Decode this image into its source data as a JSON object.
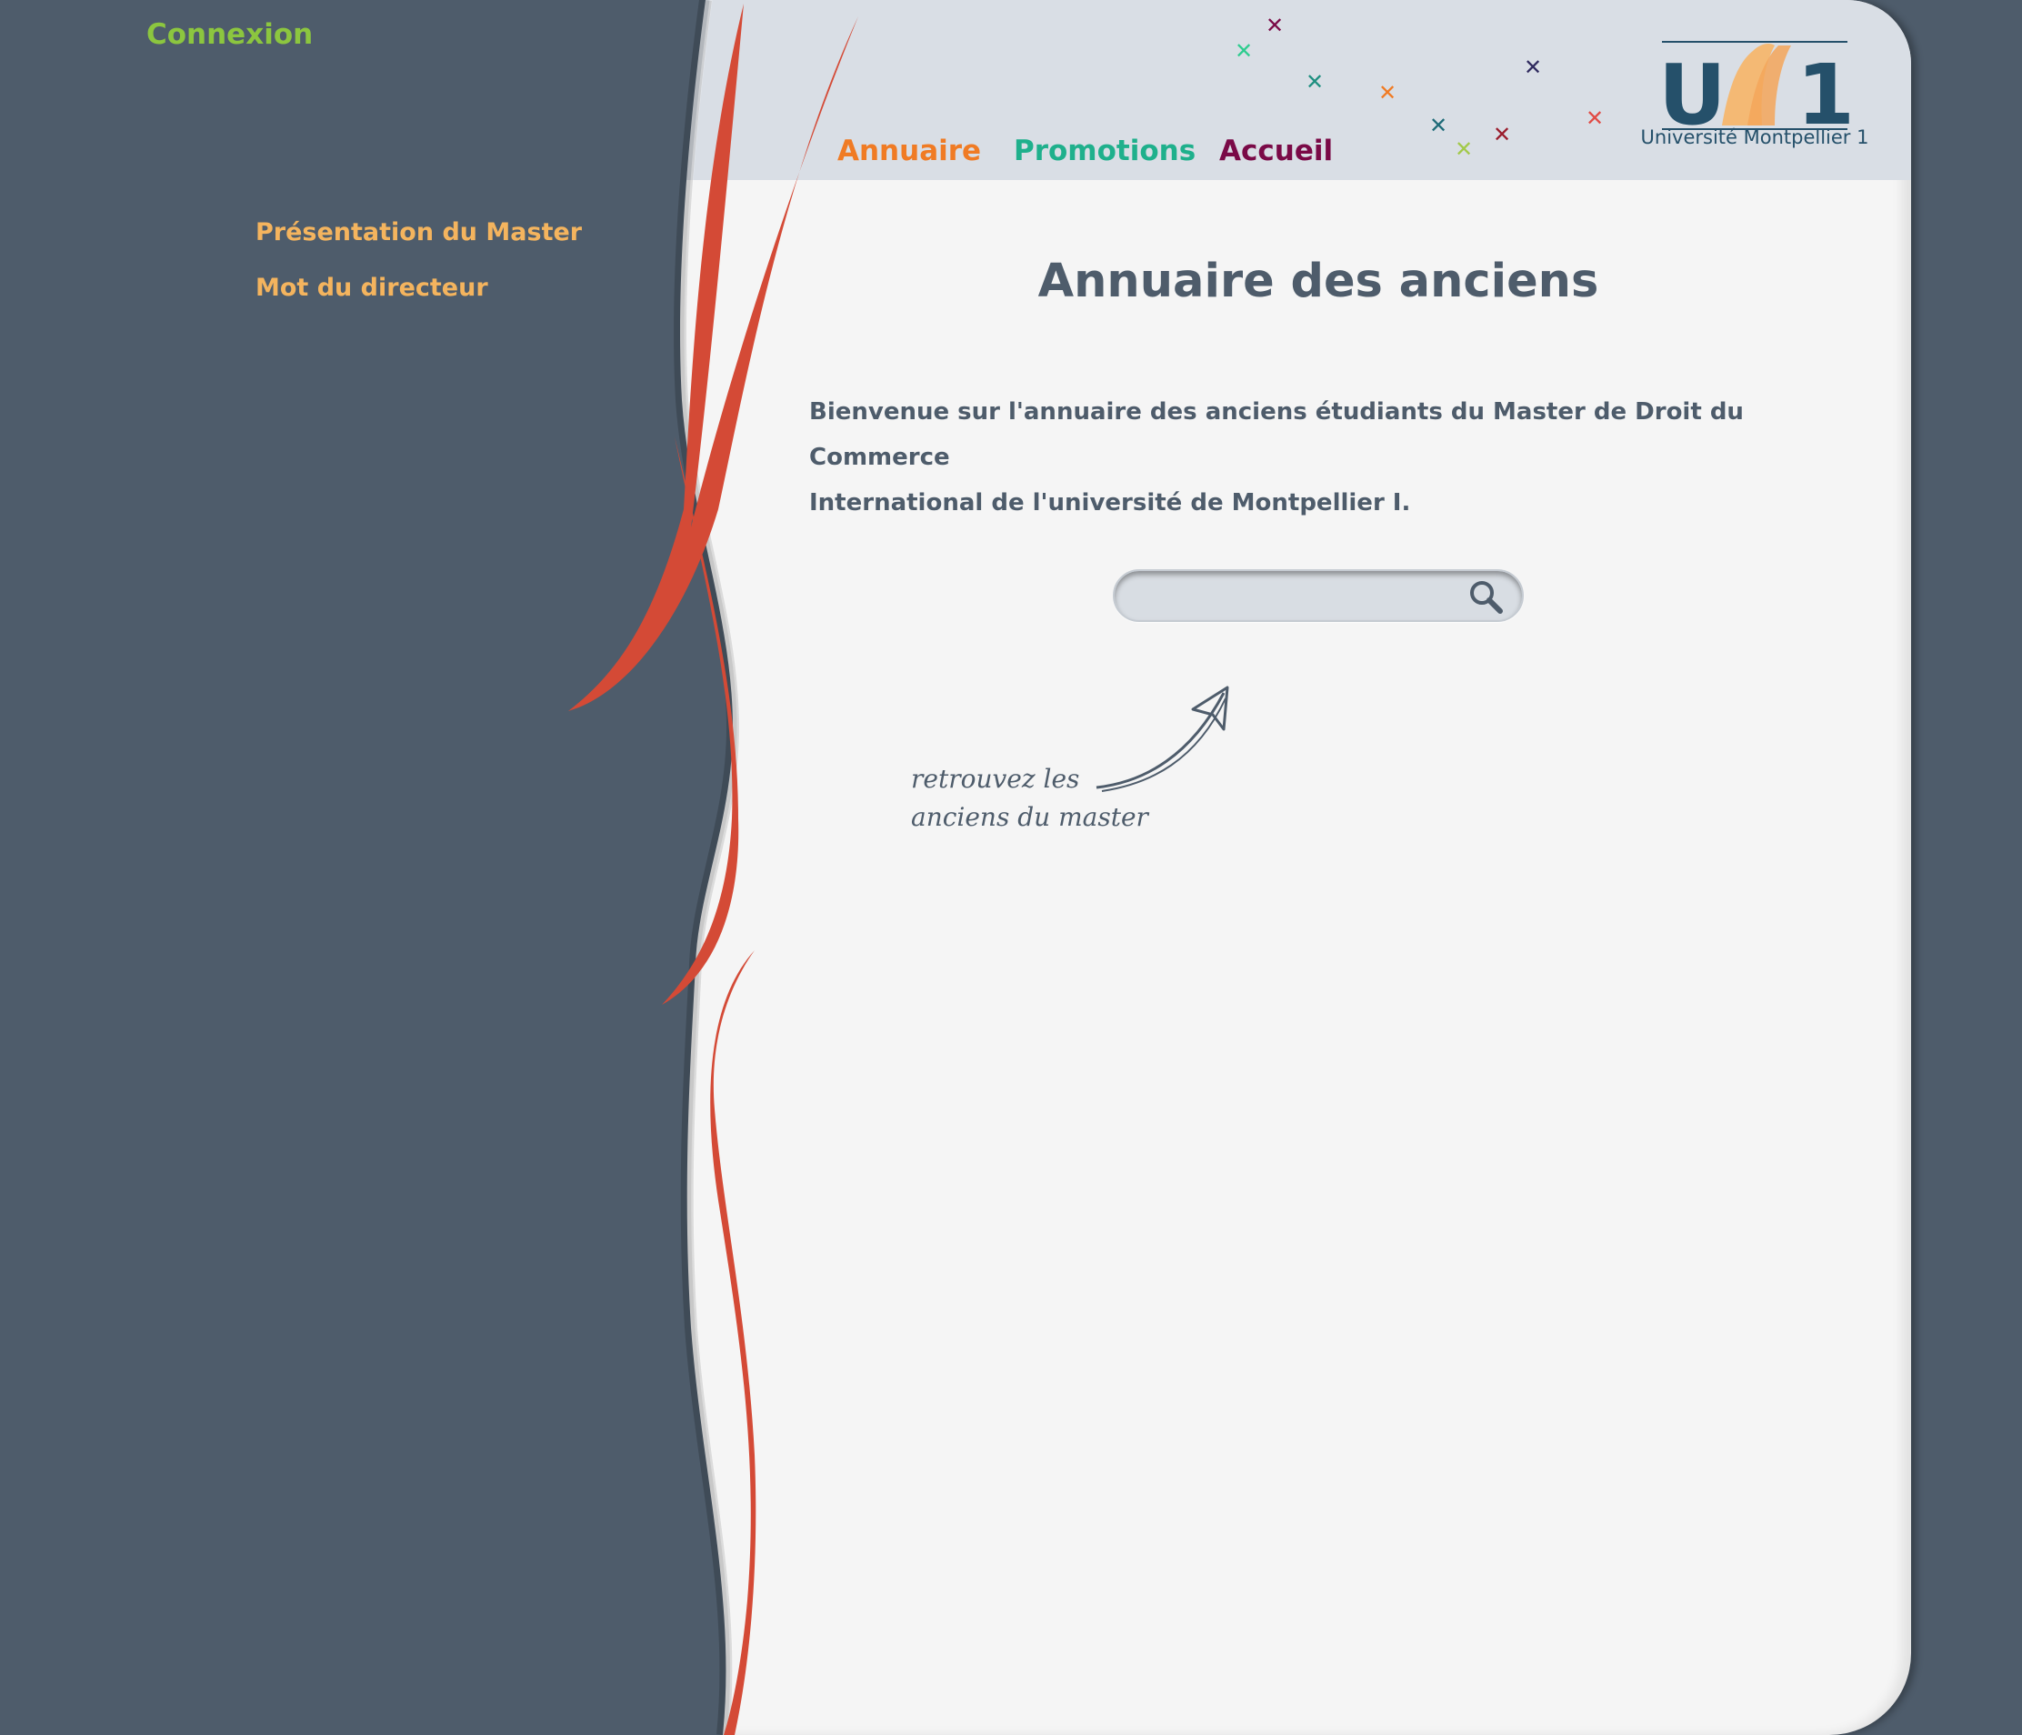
{
  "sidebar": {
    "login_label": "Connexion",
    "items": [
      {
        "label": "Présentation du Master"
      },
      {
        "label": "Mot du directeur"
      }
    ]
  },
  "header": {
    "nav": [
      {
        "label": "Annuaire",
        "color": "#f07b24"
      },
      {
        "label": "Promotions",
        "color": "#1fb08c"
      },
      {
        "label": "Accueil",
        "color": "#7a0a47"
      }
    ],
    "logo": {
      "text": "UM1",
      "caption": "Université Montpellier 1"
    },
    "decor": "colored-cross-icons"
  },
  "main": {
    "title": "Annuaire des anciens",
    "intro_line1": "Bienvenue sur l'annuaire des anciens étudiants du Master de Droit du Commerce",
    "intro_line2": "International de l'université de Montpellier I.",
    "search": {
      "value": "",
      "placeholder": "",
      "icon": "search-icon"
    },
    "hint_line1": "retrouvez les",
    "hint_line2": "anciens  du master"
  },
  "colors": {
    "background": "#4e5c6b",
    "panel": "#f5f5f5",
    "header": "#d9dee5",
    "ribbon": "#d44a36"
  }
}
